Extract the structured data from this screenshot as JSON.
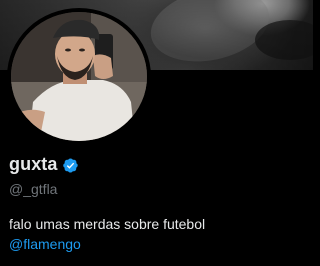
{
  "profile": {
    "name": "guxta",
    "handle": "@_gtfla",
    "bio": "falo umas merdas sobre futebol",
    "bio_mention": "@flamengo",
    "verified": true
  },
  "colors": {
    "background": "#000000",
    "primary_text": "#e7e9ea",
    "secondary_text": "#71767b",
    "link": "#1d9bf0",
    "verified_badge": "#1d9bf0"
  },
  "icons": {
    "verified": "verified-badge-icon"
  }
}
